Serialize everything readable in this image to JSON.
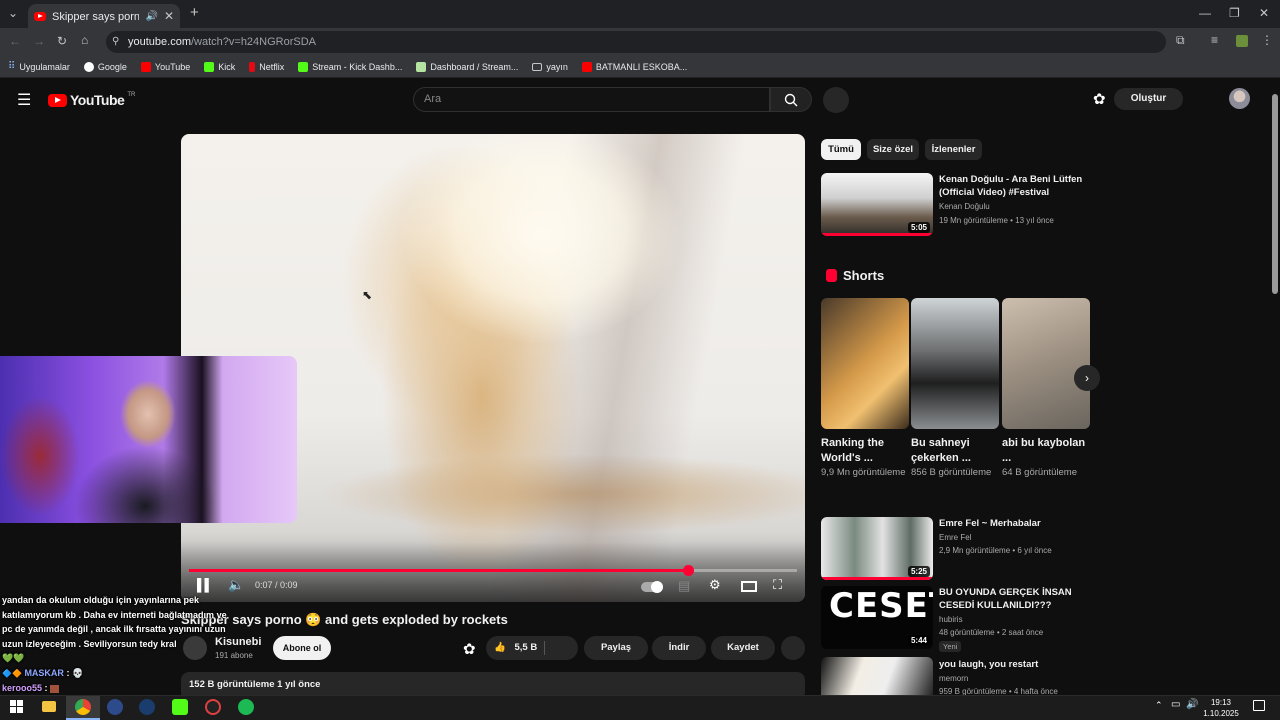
{
  "browser": {
    "tab_title": "Skipper says porno 😳 and",
    "url_host": "youtube.com",
    "url_path": "/watch?v=h24NGRorSDA",
    "bookmarks": [
      {
        "label": "Uygulamalar",
        "color": "#8ab4f8"
      },
      {
        "label": "Google",
        "color": "#34a853"
      },
      {
        "label": "YouTube",
        "color": "#ff0000"
      },
      {
        "label": "Kick",
        "color": "#53fc18"
      },
      {
        "label": "Netflix",
        "color": "#e50914"
      },
      {
        "label": "Stream - Kick Dashb...",
        "color": "#53fc18"
      },
      {
        "label": "Dashboard / Stream...",
        "color": "#9aa0a6"
      },
      {
        "label": "yayın",
        "color": "#9aa0a6"
      },
      {
        "label": "BATMANLI ESKOBA...",
        "color": "#ff0000"
      }
    ]
  },
  "youtube": {
    "logo": "YouTube",
    "region": "TR",
    "search_placeholder": "Ara",
    "create_label": "Oluştur"
  },
  "player": {
    "time": "0:07 / 0:09",
    "progress_fraction": 0.82
  },
  "video": {
    "title": "Skipper says porno 😳 and gets exploded by rockets",
    "channel": "Kisunebi",
    "subscribers": "191 abone",
    "subscribe_label": "Abone ol",
    "likes": "5,5 B",
    "share_label": "Paylaş",
    "download_label": "İndir",
    "save_label": "Kaydet",
    "views_date": "152 B görüntüleme  1 yıl önce"
  },
  "chat": {
    "message": "yandan da okulum olduğu için yayınlarına pek katılamıyorum kb . Daha ev interneti bağlatmadım ve pc de yanımda değil , ancak ilk fırsatta yayınını uzun uzun izleyeceğim . Seviliyorsun tedy kral",
    "hearts": "💚💚",
    "user1": "MASKAR",
    "user1_suffix": ": 💀",
    "user2": "kerooo55",
    "user2_suffix": ":"
  },
  "sidebar": {
    "chips": [
      "Tümü",
      "Size özel",
      "İzlenenler"
    ],
    "shorts_heading": "Shorts",
    "recommendations": [
      {
        "title": "Kenan Doğulu - Ara Beni Lütfen (Official Video) #Festival",
        "channel": "Kenan Doğulu",
        "meta": "19 Mn görüntüleme • 13 yıl önce",
        "duration": "5:05"
      },
      {
        "title": "Emre Fel ~ Merhabalar",
        "channel": "Emre Fel",
        "meta": "2,9 Mn görüntüleme • 6 yıl önce",
        "duration": "5:25"
      },
      {
        "title": "BU OYUNDA GERÇEK İNSAN CESEDİ KULLANILDI???",
        "channel": "hubiris",
        "meta": "48 görüntüleme • 2 saat önce",
        "badge": "Yeni",
        "duration": "5:44"
      },
      {
        "title": "you laugh, you restart",
        "channel": "memorn",
        "meta": "959 B görüntüleme • 4 hafta önce"
      }
    ],
    "shorts": [
      {
        "title": "Ranking the World's ...",
        "views": "9,9 Mn görüntüleme"
      },
      {
        "title": "Bu sahneyi çekerken ...",
        "views": "856 B görüntüleme"
      },
      {
        "title": "abi bu kaybolan ...",
        "views": "64 B görüntüleme"
      }
    ]
  },
  "taskbar": {
    "time": "19:13",
    "date": "1.10.2025"
  },
  "colors": {
    "accent": "#ff0033",
    "background": "#0f0f0f"
  }
}
